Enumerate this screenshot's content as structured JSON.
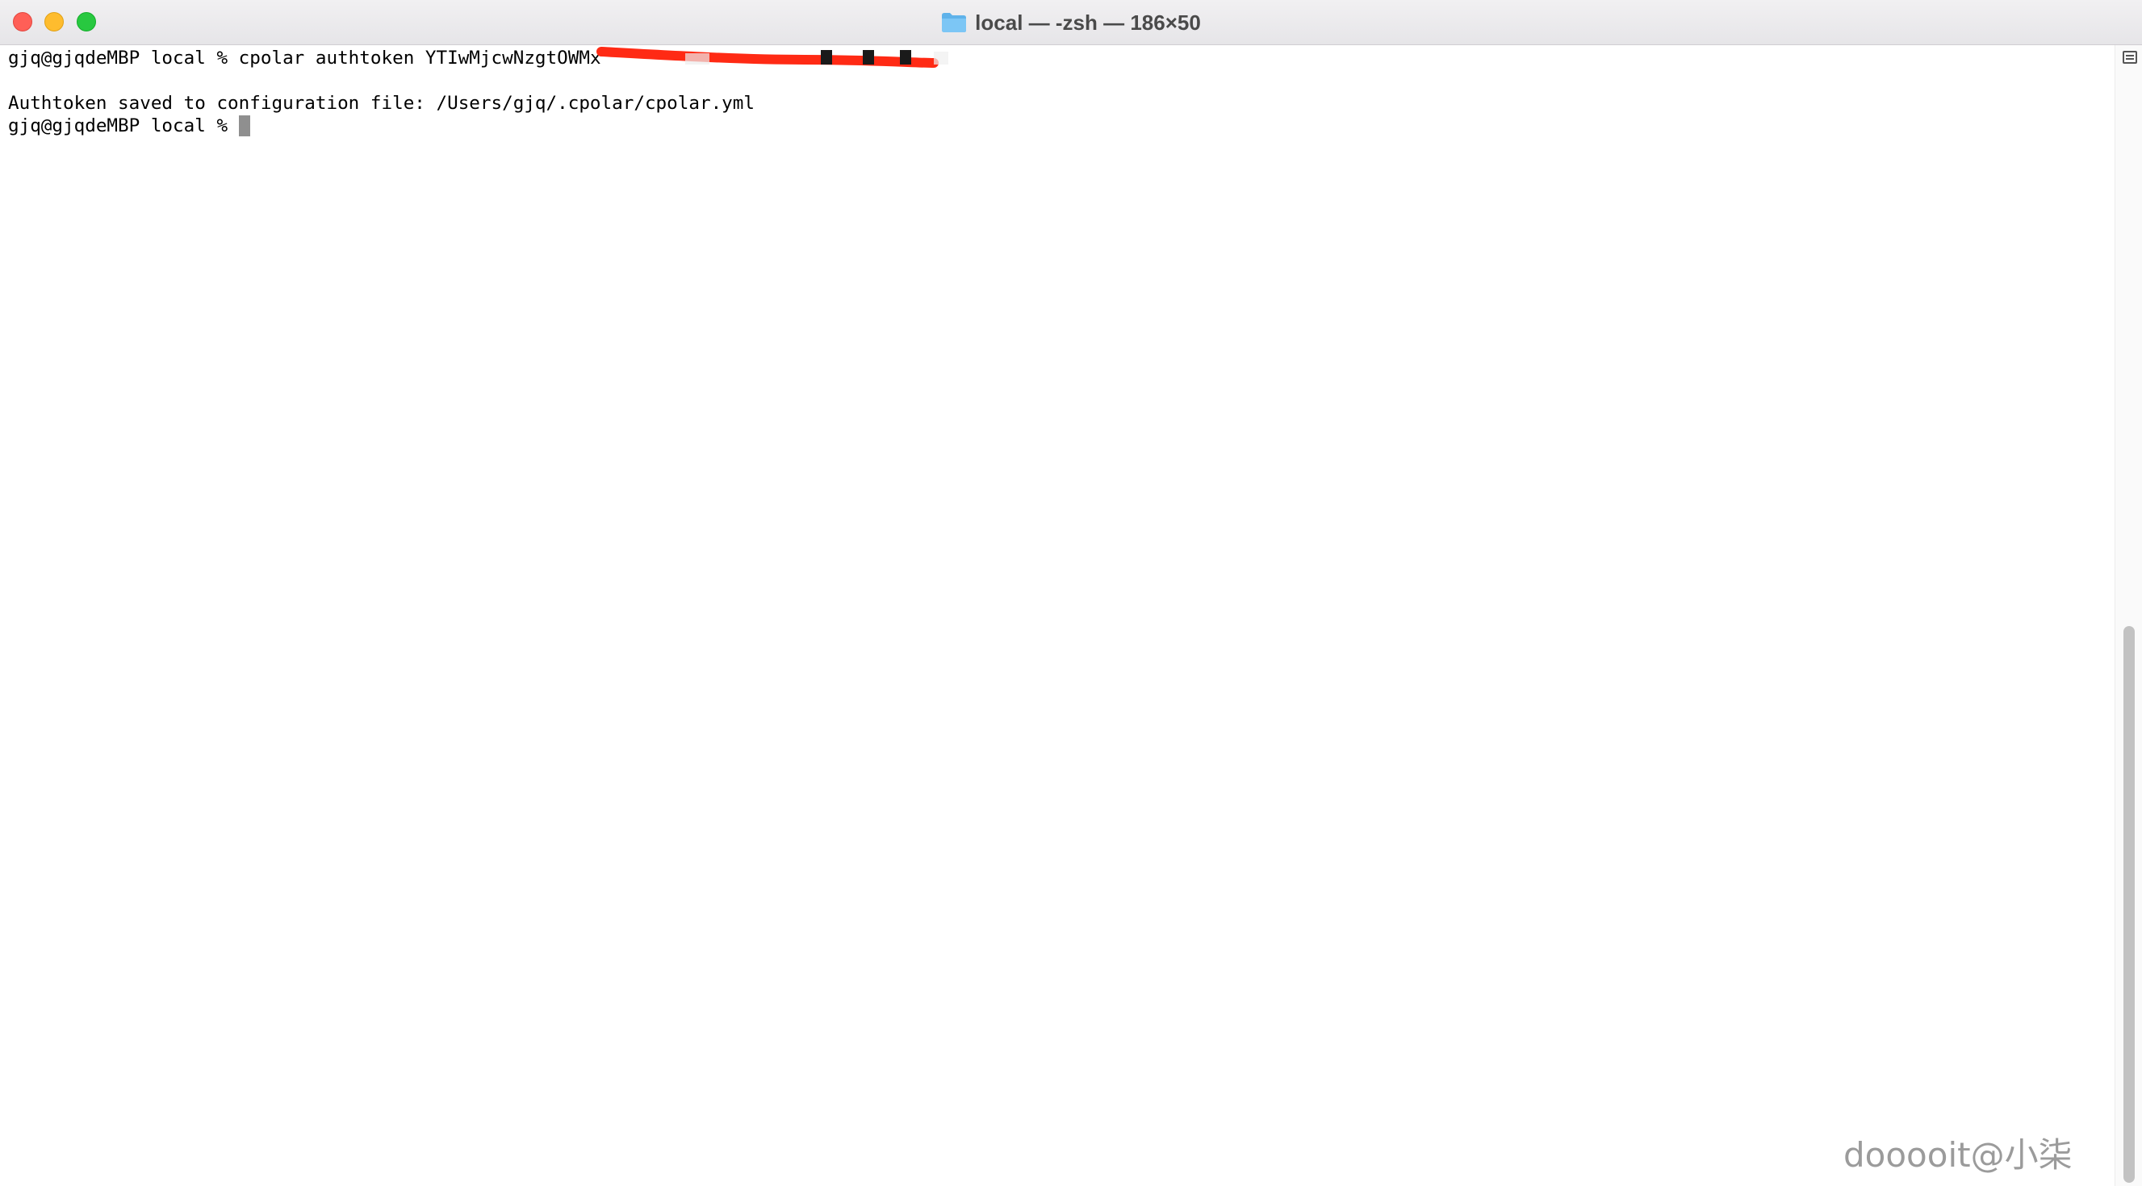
{
  "window": {
    "title": "local — -zsh — 186×50",
    "title_icon": "folder-icon",
    "controls": [
      "close",
      "minimize",
      "zoom"
    ]
  },
  "terminal": {
    "prompt": "gjq@gjqdeMBP local % ",
    "command_prefix": "cpolar authtoken YTIwMjcwNzgtOWMx",
    "command_redacted": true,
    "output": "Authtoken saved to configuration file: /Users/gjq/.cpolar/cpolar.yml",
    "current_prompt": "gjq@gjqdeMBP local % ",
    "cursor_color": "#8f8f8f"
  },
  "colors": {
    "close": "#ff5f57",
    "minimize": "#febc2e",
    "zoom": "#28c840",
    "redaction": "#ff2a14"
  },
  "watermark": "dooooit@小柒"
}
